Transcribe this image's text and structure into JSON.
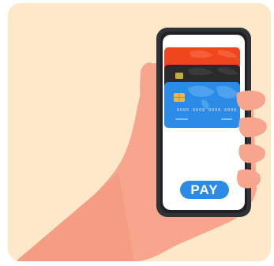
{
  "payment": {
    "pay_label": "PAY",
    "card_number": "0000 0000 0000 0000"
  },
  "colors": {
    "background": "#fde8c9",
    "skin": "#f7a58c",
    "card_front": "#2b8be6",
    "card_middle": "#2a2a2a",
    "card_back": "#f0461e",
    "phone_frame": "#2f3236",
    "pay_button": "#2b8be6"
  },
  "icons": {
    "chip": "card-chip-icon",
    "map": "world-map-icon"
  }
}
